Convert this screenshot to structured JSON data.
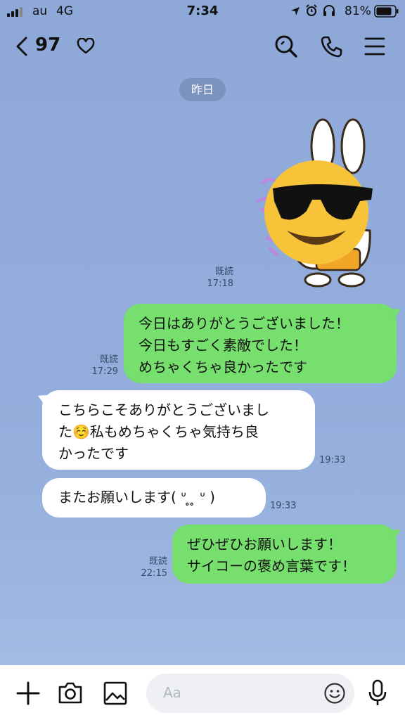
{
  "status_bar": {
    "carrier": "au",
    "network": "4G",
    "time": "7:34",
    "battery_percent": "81%",
    "icons": [
      "signal-icon",
      "location-arrow-icon",
      "alarm-icon",
      "headphones-icon",
      "battery-icon"
    ]
  },
  "header": {
    "unread_count": "97",
    "icons": [
      "back-chevron-icon",
      "heart-icon",
      "search-icon",
      "phone-icon",
      "menu-icon"
    ]
  },
  "date_separator": "昨日",
  "messages": [
    {
      "type": "sticker",
      "side": "sent",
      "read_label": "既読",
      "time": "17:18",
      "description": "bunny-sunglasses-sticker"
    },
    {
      "type": "text",
      "side": "sent",
      "read_label": "既読",
      "time": "17:29",
      "lines": [
        "今日はありがとうございました！",
        "今日もすごく素敵でした！",
        "めちゃくちゃ良かったです"
      ]
    },
    {
      "type": "text",
      "side": "received",
      "time": "19:33",
      "lines": [
        "こちらこそありがとうございまし",
        "た☺️私もめちゃくちゃ気持ち良",
        "かったです"
      ]
    },
    {
      "type": "text",
      "side": "received",
      "time": "19:33",
      "lines": [
        "またお願いします(  ᐡ ̥ ̥ ᐡ )"
      ]
    },
    {
      "type": "text",
      "side": "sent",
      "read_label": "既読",
      "time": "22:15",
      "lines": [
        "ぜひぜひお願いします！",
        "サイコーの褒め言葉です！"
      ]
    }
  ],
  "input_bar": {
    "placeholder": "Aa",
    "icons": [
      "plus-icon",
      "camera-icon",
      "image-icon",
      "emoji-icon",
      "microphone-icon"
    ]
  },
  "colors": {
    "background": "#93addc",
    "sent_bubble": "#76df6d",
    "received_bubble": "#ffffff",
    "date_pill": "#7c8fb6"
  }
}
